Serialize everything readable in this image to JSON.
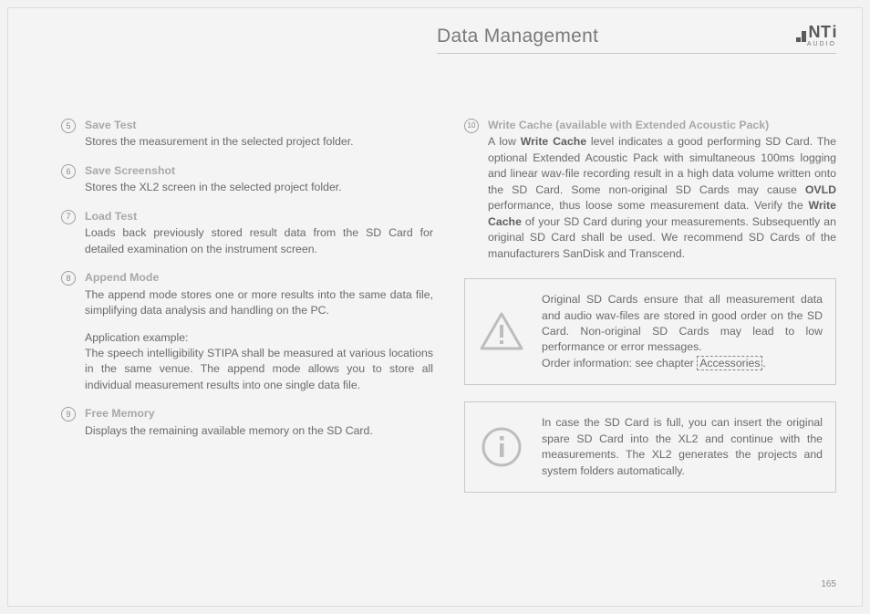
{
  "header": {
    "title": "Data Management",
    "brand_sub": "AUDIO"
  },
  "page_number": "165",
  "left": {
    "i5": {
      "n": "5",
      "h": "Save Test",
      "b": "Stores the measurement in the selected project folder."
    },
    "i6": {
      "n": "6",
      "h": "Save Screenshot",
      "b": "Stores the XL2 screen in the selected project folder."
    },
    "i7": {
      "n": "7",
      "h": "Load Test",
      "b": "Loads back previously stored result data from the SD Card for detailed examination on the instrument screen."
    },
    "i8": {
      "n": "8",
      "h": "Append Mode",
      "b1": "The append mode stores one or more results into the same data file, simplifying data analysis and handling on the PC.",
      "ex_h": "Application example:",
      "ex": "The speech intelligibility STIPA shall be measured at various locations in the same venue. The append mode allows you to store all individual measurement results into one single data file."
    },
    "i9": {
      "n": "9",
      "h": "Free Memory",
      "b": "Displays the remaining available memory on the SD Card."
    }
  },
  "right": {
    "i10": {
      "n": "10",
      "h": "Write Cache (available with Extended Acoustic Pack)",
      "p_a": "A low ",
      "p_b": "Write Cache",
      "p_c": " level indicates a good performing SD Card. The optional Extended Acoustic Pack with simultaneous 100ms logging and linear wav-file recording result in a high data volume written onto the SD Card. Some non-original SD Cards may cause ",
      "p_d": "OVLD",
      "p_e": " performance, thus loose some measurement data. Verify the ",
      "p_f": "Write Cache",
      "p_g": " of your SD Card during your measurements. Subsequently an original SD Card shall be used. We recommend SD Cards of the manufacturers SanDisk and Transcend."
    },
    "warn": {
      "t1": "Original SD Cards ensure that all measurement data and audio wav-files are stored in good order on the SD Card. Non-original SD Cards may lead to low performance or error messages.",
      "t2a": "Order information: see chapter ",
      "t2b": "Accessories"
    },
    "info": {
      "t": "In case the SD Card is full, you can insert the original spare SD Card into the XL2 and continue with the measurements. The XL2 generates the projects and system folders automatically."
    }
  }
}
